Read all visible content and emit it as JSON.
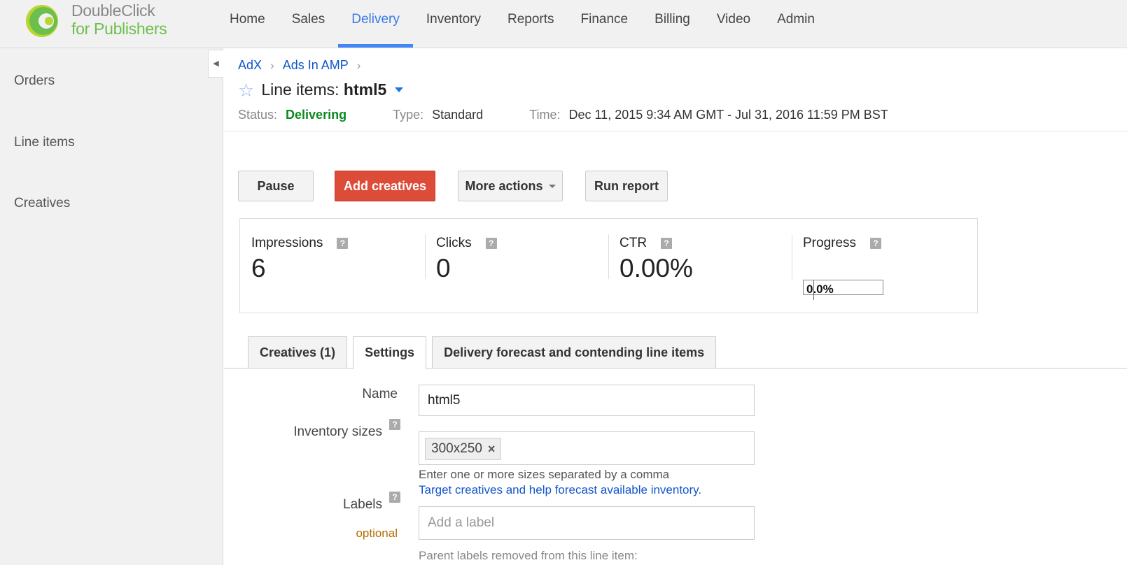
{
  "app": {
    "logo_line1": "DoubleClick",
    "logo_line2": "for Publishers",
    "brand_colors": {
      "ring_green": "#6cbf4c",
      "ring_lime": "#b9d531",
      "active_nav": "#4285f4"
    }
  },
  "nav": {
    "items": [
      {
        "label": "Home",
        "active": false
      },
      {
        "label": "Sales",
        "active": false
      },
      {
        "label": "Delivery",
        "active": true
      },
      {
        "label": "Inventory",
        "active": false
      },
      {
        "label": "Reports",
        "active": false
      },
      {
        "label": "Finance",
        "active": false
      },
      {
        "label": "Billing",
        "active": false
      },
      {
        "label": "Video",
        "active": false
      },
      {
        "label": "Admin",
        "active": false
      }
    ]
  },
  "sidebar": {
    "items": [
      {
        "label": "Orders"
      },
      {
        "label": "Line items"
      },
      {
        "label": "Creatives"
      }
    ],
    "collapse_icon": "chevron-left-icon"
  },
  "breadcrumb": {
    "items": [
      "AdX",
      "Ads In AMP"
    ],
    "separator": "›"
  },
  "header": {
    "title_prefix": "Line items:",
    "title_name": "html5",
    "status_label": "Status:",
    "status_value": "Delivering",
    "status_color": "#0a8a1f",
    "type_label": "Type:",
    "type_value": "Standard",
    "time_label": "Time:",
    "time_value": "Dec 11, 2015 9:34 AM GMT - Jul 31, 2016 11:59 PM BST"
  },
  "actions": {
    "pause": "Pause",
    "add_creatives": "Add creatives",
    "more_actions": "More actions",
    "run_report": "Run report",
    "accent_red": "#dd4b39"
  },
  "stats": {
    "help_glyph": "?",
    "impressions": {
      "label": "Impressions",
      "value": "6"
    },
    "clicks": {
      "label": "Clicks",
      "value": "0"
    },
    "ctr": {
      "label": "CTR",
      "value": "0.00%"
    },
    "progress": {
      "label": "Progress",
      "value": "0.0%",
      "fraction": 0.0
    }
  },
  "tabs": [
    {
      "label": "Creatives (1)",
      "active": false
    },
    {
      "label": "Settings",
      "active": true
    },
    {
      "label": "Delivery forecast and contending line items",
      "active": false
    }
  ],
  "form": {
    "name_label": "Name",
    "name_value": "html5",
    "sizes_label": "Inventory sizes",
    "sizes_chip": "300x250",
    "sizes_chip_remove": "×",
    "sizes_hint": "Enter one or more sizes separated by a comma",
    "sizes_link": "Target creatives and help forecast available inventory.",
    "labels_label": "Labels",
    "labels_optional": "optional",
    "labels_placeholder": "Add a label",
    "parent_labels_note": "Parent labels removed from this line item:"
  }
}
